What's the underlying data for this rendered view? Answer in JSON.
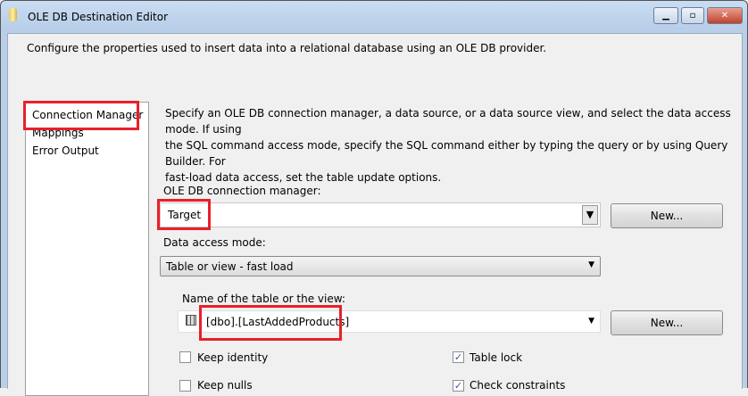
{
  "window": {
    "title": "OLE DB Destination Editor"
  },
  "description": "Configure the properties used to insert data into a relational database using an OLE DB provider.",
  "nav": {
    "items": [
      {
        "label": "Connection Manager"
      },
      {
        "label": "Mappings"
      },
      {
        "label": "Error Output"
      }
    ]
  },
  "main": {
    "intro_lines": [
      "Specify an OLE DB connection manager, a data source, or a data source view, and select the data access mode. If using",
      "the SQL command access mode, specify the SQL command either by typing the query or by using Query Builder. For",
      "fast-load data access, set the table update options."
    ],
    "connection_label": "OLE DB connection manager:",
    "connection_value": "Target",
    "new_label": "New...",
    "access_mode_label": "Data access mode:",
    "access_mode_value": "Table or view - fast load",
    "table_label": "Name of the table or the view:",
    "table_value": "[dbo].[LastAddedProducts]",
    "options": [
      {
        "label": "Keep identity",
        "checked": false
      },
      {
        "label": "Table lock",
        "checked": true
      },
      {
        "label": "Keep nulls",
        "checked": false
      },
      {
        "label": "Check constraints",
        "checked": true
      }
    ]
  },
  "highlight_color": "#e8202a"
}
